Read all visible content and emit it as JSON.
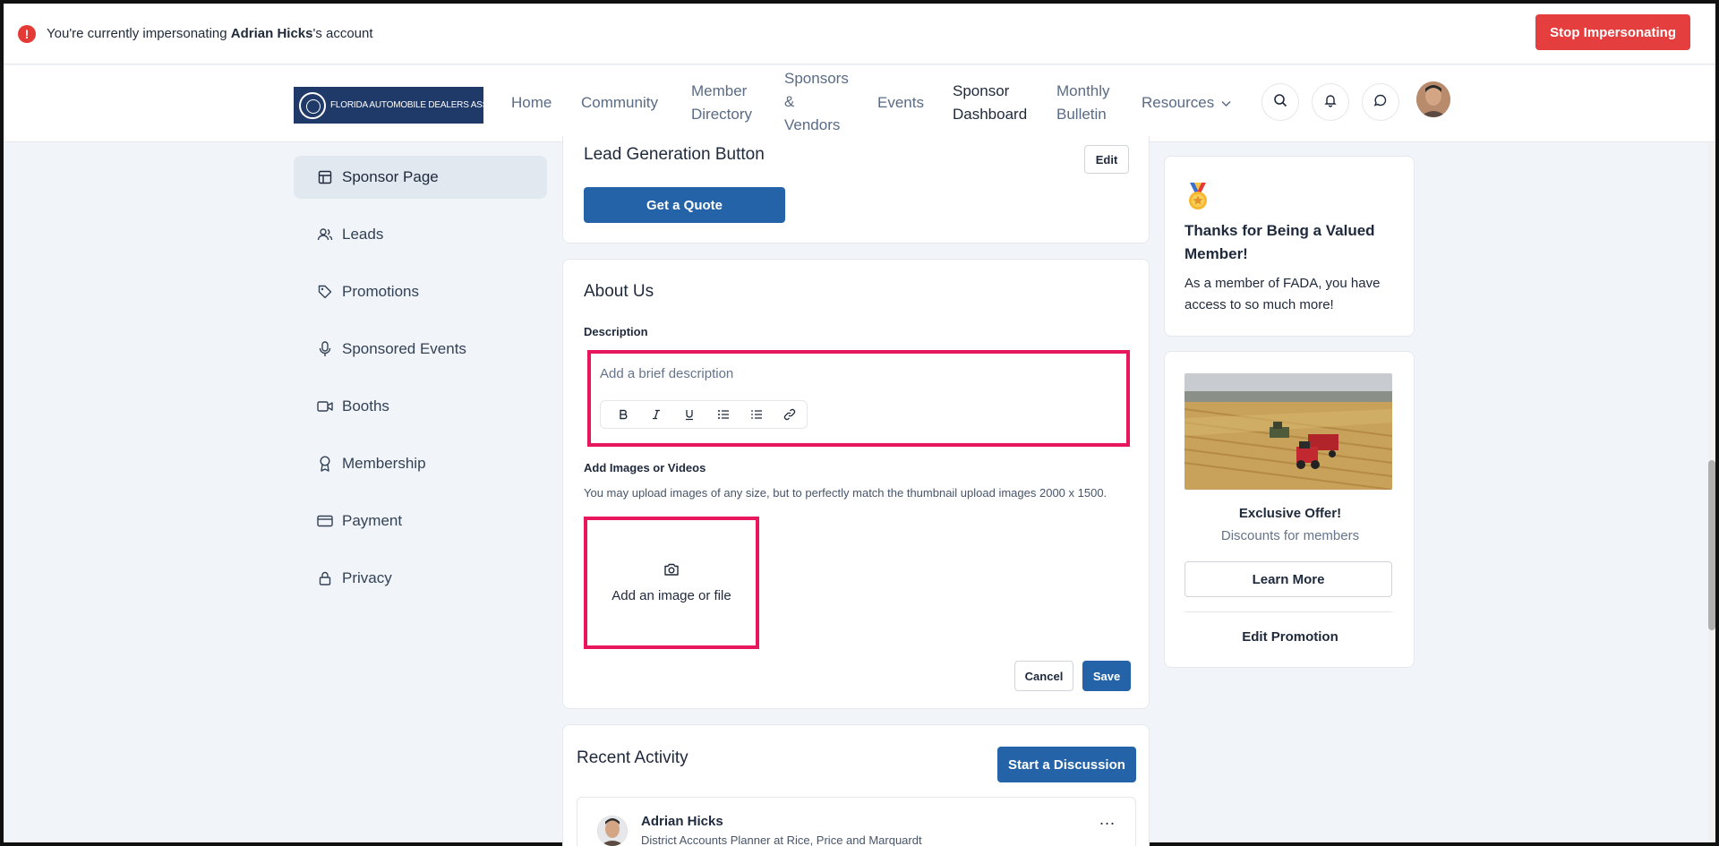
{
  "impersonation": {
    "prefix": "You're currently impersonating ",
    "user_name": "Adrian Hicks",
    "suffix": "'s account",
    "stop_label": "Stop Impersonating"
  },
  "logo": {
    "text": "FLORIDA AUTOMOBILE DEALERS ASSOCIATION"
  },
  "nav": {
    "home": "Home",
    "community": "Community",
    "member_directory_1": "Member",
    "member_directory_2": "Directory",
    "sponsors_1": "Sponsors",
    "sponsors_2": "&",
    "sponsors_3": "Vendors",
    "events": "Events",
    "sponsor_dashboard_1": "Sponsor",
    "sponsor_dashboard_2": "Dashboard",
    "bulletin_1": "Monthly",
    "bulletin_2": "Bulletin",
    "resources": "Resources"
  },
  "sidebar": {
    "items": [
      {
        "label": "Sponsor Page",
        "icon": "layout-icon",
        "active": true
      },
      {
        "label": "Leads",
        "icon": "users-icon"
      },
      {
        "label": "Promotions",
        "icon": "tag-icon"
      },
      {
        "label": "Sponsored Events",
        "icon": "microphone-icon"
      },
      {
        "label": "Booths",
        "icon": "video-icon"
      },
      {
        "label": "Membership",
        "icon": "award-icon"
      },
      {
        "label": "Payment",
        "icon": "credit-card-icon"
      },
      {
        "label": "Privacy",
        "icon": "lock-icon"
      }
    ]
  },
  "lead_gen": {
    "title": "Lead Generation Button",
    "edit_label": "Edit",
    "button_label": "Get a Quote"
  },
  "about": {
    "title": "About Us",
    "description_label": "Description",
    "description_placeholder": "Add a brief description",
    "images_label": "Add Images or Videos",
    "images_help": "You may upload images of any size, but to perfectly match the thumbnail upload images 2000 x 1500.",
    "upload_label": "Add an image or file",
    "cancel_label": "Cancel",
    "save_label": "Save"
  },
  "activity": {
    "title": "Recent Activity",
    "start_label": "Start a Discussion",
    "post": {
      "name": "Adrian Hicks",
      "subtitle": "District Accounts Planner at Rice, Price and Marquardt",
      "more": "..."
    }
  },
  "thanks": {
    "title": "Thanks for Being a Valued Member!",
    "text": "As a member of FADA, you have access to so much more!"
  },
  "promo": {
    "title": "Exclusive Offer!",
    "subtitle": "Discounts for members",
    "learn_label": "Learn More",
    "edit_label": "Edit Promotion"
  },
  "colors": {
    "primary": "#2563a8",
    "danger": "#e53e3e",
    "highlight": "#e8175d"
  }
}
